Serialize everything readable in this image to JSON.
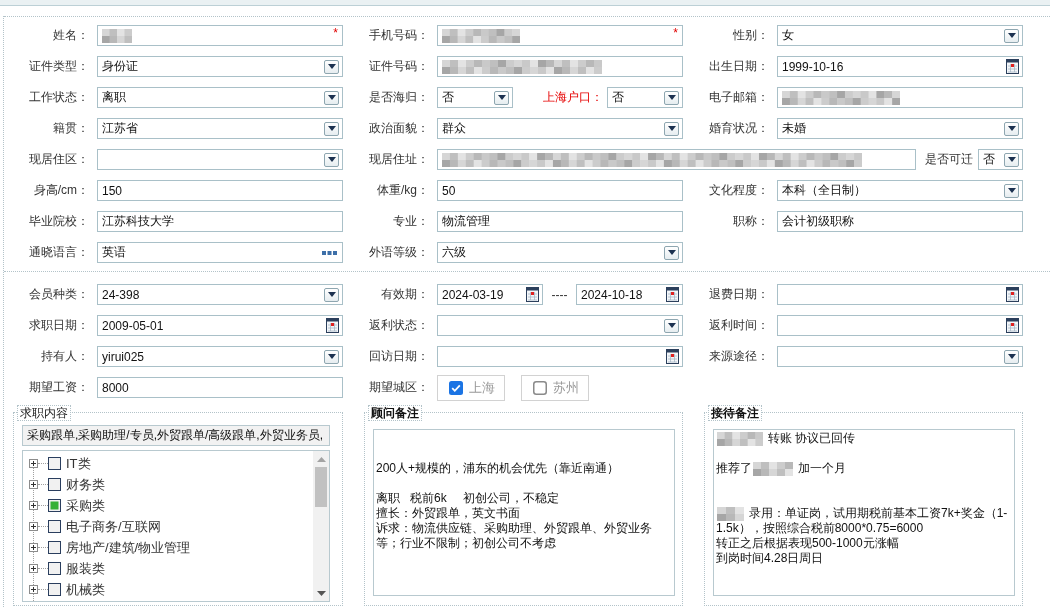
{
  "sections": [
    {
      "rows": [
        {
          "cells": [
            {
              "kind": "single",
              "label": "姓名：",
              "field": {
                "kind": "text",
                "redacted": true,
                "mark": "*"
              }
            },
            {
              "kind": "single",
              "label": "手机号码：",
              "field": {
                "kind": "text",
                "redacted": true,
                "mark": "*"
              }
            },
            {
              "kind": "single",
              "label": "性别：",
              "field": {
                "kind": "select",
                "value": "女"
              }
            }
          ]
        },
        {
          "cells": [
            {
              "kind": "single",
              "label": "证件类型：",
              "field": {
                "kind": "select",
                "value": "身份证"
              }
            },
            {
              "kind": "single",
              "label": "证件号码：",
              "field": {
                "kind": "text",
                "redacted": true
              }
            },
            {
              "kind": "single",
              "label": "出生日期：",
              "field": {
                "kind": "date",
                "value": "1999-10-16"
              }
            }
          ]
        },
        {
          "cells": [
            {
              "kind": "single",
              "label": "工作状态：",
              "field": {
                "kind": "select",
                "value": "离职"
              }
            },
            {
              "kind": "split",
              "label": "是否海归：",
              "field": {
                "kind": "select",
                "value": "否"
              },
              "sublabel": {
                "text": "上海户口：",
                "highlighted": true
              },
              "subfield": {
                "kind": "select",
                "value": "否"
              }
            },
            {
              "kind": "single",
              "label": "电子邮箱：",
              "field": {
                "kind": "text",
                "redacted": true
              }
            }
          ]
        },
        {
          "cells": [
            {
              "kind": "single",
              "label": "籍贯：",
              "field": {
                "kind": "select",
                "value": "江苏省"
              }
            },
            {
              "kind": "single",
              "label": "政治面貌：",
              "field": {
                "kind": "select",
                "value": "群众"
              }
            },
            {
              "kind": "single",
              "label": "婚育状况：",
              "field": {
                "kind": "select",
                "value": "未婚"
              }
            }
          ]
        },
        {
          "cells": [
            {
              "kind": "single",
              "label": "现居住区：",
              "field": {
                "kind": "select"
              }
            },
            {
              "kind": "wide",
              "label": "现居住址：",
              "field": {
                "kind": "text",
                "redacted": true
              },
              "sublabel": {
                "text": "是否可迁",
                "highlighted": false
              },
              "subfield": {
                "kind": "select",
                "value": "否"
              }
            }
          ]
        },
        {
          "cells": [
            {
              "kind": "single",
              "label": "身高/cm：",
              "field": {
                "kind": "text",
                "value": "150"
              }
            },
            {
              "kind": "single",
              "label": "体重/kg：",
              "field": {
                "kind": "text",
                "value": "50"
              }
            },
            {
              "kind": "single",
              "label": "文化程度：",
              "field": {
                "kind": "select",
                "value": "本科（全日制）"
              }
            }
          ]
        },
        {
          "cells": [
            {
              "kind": "single",
              "label": "毕业院校：",
              "field": {
                "kind": "text",
                "value": "江苏科技大学"
              }
            },
            {
              "kind": "single",
              "label": "专业：",
              "field": {
                "kind": "text",
                "value": "物流管理"
              }
            },
            {
              "kind": "single",
              "label": "职称：",
              "field": {
                "kind": "text",
                "value": "会计初级职称"
              }
            }
          ]
        },
        {
          "cells": [
            {
              "kind": "single",
              "label": "通晓语言：",
              "field": {
                "kind": "lookup",
                "value": "英语"
              }
            },
            {
              "kind": "single",
              "label": "外语等级：",
              "field": {
                "kind": "select",
                "value": "六级"
              }
            }
          ]
        }
      ]
    },
    {
      "rows": [
        {
          "cells": [
            {
              "kind": "single",
              "label": "会员种类：",
              "field": {
                "kind": "select",
                "value": "24-398"
              }
            },
            {
              "kind": "daterange",
              "label": "有效期：",
              "field": {
                "kind": "date",
                "value": "2024-03-19"
              },
              "separator": "----",
              "subfield": {
                "kind": "date",
                "value": "2024-10-18"
              }
            },
            {
              "kind": "single",
              "label": "退费日期：",
              "field": {
                "kind": "date"
              }
            }
          ]
        },
        {
          "cells": [
            {
              "kind": "single",
              "label": "求职日期：",
              "field": {
                "kind": "date",
                "value": "2009-05-01"
              }
            },
            {
              "kind": "single",
              "label": "返利状态：",
              "field": {
                "kind": "select"
              }
            },
            {
              "kind": "single",
              "label": "返利时间：",
              "field": {
                "kind": "date"
              }
            }
          ]
        },
        {
          "cells": [
            {
              "kind": "single",
              "label": "持有人：",
              "field": {
                "kind": "select",
                "value": "yirui025"
              }
            },
            {
              "kind": "single",
              "label": "回访日期：",
              "field": {
                "kind": "date"
              }
            },
            {
              "kind": "single",
              "label": "来源途径：",
              "field": {
                "kind": "select"
              }
            }
          ]
        },
        {
          "cells": [
            {
              "kind": "single",
              "label": "期望工资：",
              "field": {
                "kind": "text",
                "value": "8000"
              }
            },
            {
              "kind": "checks",
              "label": "期望城区：",
              "options": [
                {
                  "label": "上海",
                  "checked": true
                },
                {
                  "label": "苏州",
                  "checked": false
                }
              ]
            }
          ]
        }
      ]
    }
  ],
  "panels": [
    {
      "kind": "tree",
      "legend": "求职内容",
      "summary": "采购跟单,采购助理/专员,外贸跟单/高级跟单,外贸业务员,",
      "items": [
        {
          "label": "IT类",
          "checked": false,
          "expanded": false
        },
        {
          "label": "财务类",
          "checked": false,
          "expanded": false
        },
        {
          "label": "采购类",
          "checked": true,
          "expanded": false
        },
        {
          "label": "电子商务/互联网",
          "checked": false,
          "expanded": false
        },
        {
          "label": "房地产/建筑/物业管理",
          "checked": false,
          "expanded": false
        },
        {
          "label": "服装类",
          "checked": false,
          "expanded": false
        },
        {
          "label": "机械类",
          "checked": false,
          "expanded": false
        }
      ]
    },
    {
      "kind": "notes",
      "legend": "顾问备注",
      "lines": [
        {
          "kind": "blank"
        },
        {
          "kind": "blank"
        },
        {
          "kind": "text",
          "text": "200人+规模的，浦东的机会优先（靠近南通）"
        },
        {
          "kind": "blank"
        },
        {
          "kind": "text",
          "text": "离职   税前6k     初创公司，不稳定"
        },
        {
          "kind": "text",
          "text": "擅长：外贸跟单，英文书面"
        },
        {
          "kind": "text",
          "text": "诉求：物流供应链、采购助理、外贸跟单、外贸业务"
        },
        {
          "kind": "text",
          "text": "等；行业不限制；初创公司不考虑"
        }
      ]
    },
    {
      "kind": "notes",
      "legend": "接待备注",
      "lines": [
        {
          "kind": "mixed",
          "parts": [
            {
              "kind": "redacted"
            },
            {
              "kind": "text",
              "text": "转账 协议已回传"
            }
          ]
        },
        {
          "kind": "blank"
        },
        {
          "kind": "mixed",
          "parts": [
            {
              "kind": "text",
              "text": "推荐了"
            },
            {
              "kind": "redacted"
            },
            {
              "kind": "text",
              "text": "加一个月"
            }
          ]
        },
        {
          "kind": "blank"
        },
        {
          "kind": "blank"
        },
        {
          "kind": "mixed",
          "parts": [
            {
              "kind": "redacted"
            },
            {
              "kind": "text",
              "text": "录用：单证岗，试用期税前基本工资7k+奖金（1-"
            }
          ]
        },
        {
          "kind": "text",
          "text": "1.5k），按照综合税前8000*0.75=6000"
        },
        {
          "kind": "text",
          "text": "转正之后根据表现500-1000元涨幅"
        },
        {
          "kind": "text",
          "text": "到岗时间4.28日周日"
        }
      ]
    }
  ]
}
